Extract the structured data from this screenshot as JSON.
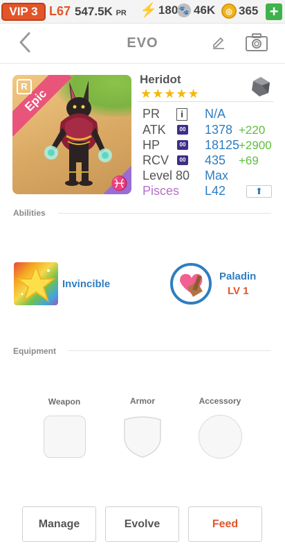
{
  "topbar": {
    "vip": "VIP 3",
    "level": "L67",
    "power_value": "547.5K",
    "power_unit": "PR",
    "energy": "180",
    "paw": "46K",
    "coins": "365",
    "plus_label": "+"
  },
  "header": {
    "title": "EVO"
  },
  "monster": {
    "name": "Heridot",
    "rarity": "Epic",
    "rarity_badge": "R",
    "stars": "★★★★★",
    "zodiac_symbol": "♓",
    "stats": [
      {
        "label": "PR",
        "value": "N/A",
        "bonus": "",
        "badge": "i"
      },
      {
        "label": "ATK",
        "value": "1378",
        "bonus": "+220",
        "badge": "00"
      },
      {
        "label": "HP",
        "value": "18125",
        "bonus": "+2900",
        "badge": "00"
      },
      {
        "label": "RCV",
        "value": "435",
        "bonus": "+69",
        "badge": "00"
      },
      {
        "label": "Level 80",
        "value": "Max",
        "bonus": "",
        "badge": ""
      },
      {
        "label": "Pisces",
        "value": "L42",
        "bonus": "",
        "badge": ""
      }
    ],
    "upgrade_icon": "⬆"
  },
  "abilities": {
    "section_title": "Abilities",
    "primary": {
      "name": "Invincible"
    },
    "secondary": {
      "name": "Paladin",
      "level": "LV 1"
    }
  },
  "equipment": {
    "section_title": "Equipment",
    "slots": [
      {
        "label": "Weapon"
      },
      {
        "label": "Armor"
      },
      {
        "label": "Accessory"
      }
    ]
  },
  "actions": {
    "manage": "Manage",
    "evolve": "Evolve",
    "feed": "Feed"
  },
  "colors": {
    "accent_orange": "#e2552a",
    "link_blue": "#2f7dc0",
    "bonus_green": "#5bbf3a",
    "star_gold": "#f5b800",
    "epic_pink": "#e9547b",
    "pisces_purple": "#b471c8"
  }
}
